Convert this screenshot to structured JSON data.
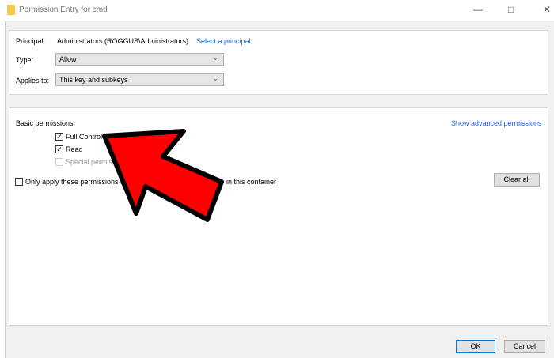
{
  "window": {
    "title": "Permission Entry for cmd"
  },
  "principal": {
    "label": "Principal:",
    "value": "Administrators (ROGGUS\\Administrators)",
    "link": "Select a principal"
  },
  "type": {
    "label": "Type:",
    "value": "Allow"
  },
  "applies_to": {
    "label": "Applies to:",
    "value": "This key and subkeys"
  },
  "permissions": {
    "heading": "Basic permissions:",
    "advanced_link": "Show advanced permissions",
    "items": [
      {
        "label": "Full Control",
        "checked": true
      },
      {
        "label": "Read",
        "checked": true
      },
      {
        "label": "Special permiss",
        "checked": false,
        "disabled": true
      }
    ],
    "only_apply_left": "Only apply these permissions t",
    "only_apply_right": "in this container",
    "clear_all": "Clear all"
  },
  "footer": {
    "ok": "OK",
    "cancel": "Cancel"
  },
  "colors": {
    "arrow": "#ff0000",
    "link": "#1a66c9"
  }
}
